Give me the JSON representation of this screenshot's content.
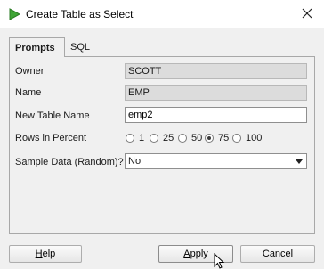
{
  "window": {
    "title": "Create Table as Select",
    "app_icon": "green-play-icon",
    "close_icon": "close-icon"
  },
  "tabs": [
    {
      "label": "Prompts",
      "active": true
    },
    {
      "label": "SQL",
      "active": false
    }
  ],
  "form": {
    "owner": {
      "label": "Owner",
      "value": "SCOTT"
    },
    "name": {
      "label": "Name",
      "value": "EMP"
    },
    "new_table_name": {
      "label": "New Table Name",
      "value": "emp2"
    },
    "rows_in_percent": {
      "label": "Rows in Percent",
      "options": [
        "1",
        "25",
        "50",
        "75",
        "100"
      ],
      "selected": "75"
    },
    "sample_data": {
      "label": "Sample Data (Random)?",
      "value": "No"
    }
  },
  "buttons": {
    "help_first": "H",
    "help_rest": "elp",
    "apply_first": "A",
    "apply_rest": "pply",
    "cancel": "Cancel"
  },
  "colors": {
    "accent_green": "#3fa535",
    "readonly_bg": "#dcdcdc"
  }
}
